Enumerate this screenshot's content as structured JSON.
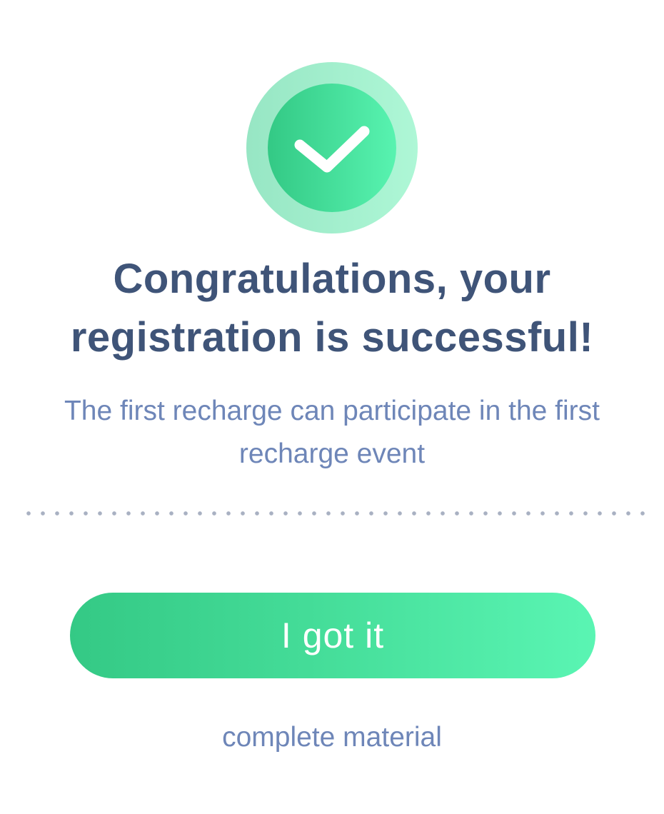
{
  "dialog": {
    "title": "Congratulations, your registration is successful!",
    "subtitle": "The first recharge can participate in the first recharge event",
    "icon": "check-circle-icon",
    "primary_button_label": "I got it",
    "secondary_link_label": "complete material"
  },
  "colors": {
    "accent_start": "#34c985",
    "accent_end": "#5af5b3",
    "title": "#3f5478",
    "body_text": "#6e86b8",
    "divider": "#a9b1c2"
  }
}
